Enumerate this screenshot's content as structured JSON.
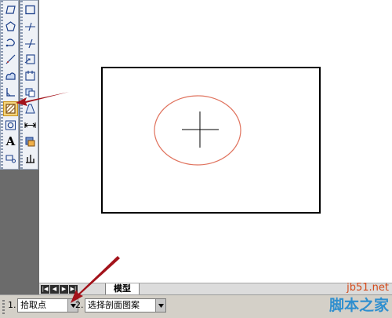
{
  "colors": {
    "toolbar_bg": "#eef1f6",
    "selected_tool": "#f3d37a",
    "ellipse_stroke": "#e0735e",
    "arrow": "#a3131b",
    "watermark_domain": "#d44a1a",
    "watermark_name": "#2f8fcf"
  },
  "toolbar_left": [
    {
      "icon": "polyline-icon"
    },
    {
      "icon": "polygon-icon"
    },
    {
      "icon": "revision-cloud-icon"
    },
    {
      "icon": "spline-icon"
    },
    {
      "icon": "region-icon"
    },
    {
      "icon": "point-icon"
    },
    {
      "icon": "hatch-icon",
      "selected": true
    },
    {
      "icon": "ellipse-icon"
    },
    {
      "icon": "multiline-text-icon",
      "label": "A"
    },
    {
      "icon": "insert-table-icon"
    }
  ],
  "toolbar_right": [
    {
      "icon": "rectangle-icon"
    },
    {
      "icon": "line-icon"
    },
    {
      "icon": "ray-icon"
    },
    {
      "icon": "insert-block-icon"
    },
    {
      "icon": "make-block-icon"
    },
    {
      "icon": "offset-icon"
    },
    {
      "icon": "gradient-icon"
    },
    {
      "icon": "dimension-icon"
    },
    {
      "icon": "layer-icon"
    },
    {
      "icon": "properties-icon"
    }
  ],
  "layout_tabs": {
    "nav_buttons": [
      "first",
      "previous",
      "next",
      "last"
    ],
    "active_tab": "模型"
  },
  "command_bar": {
    "option1_number": "1.",
    "option1_value": "拾取点",
    "option2_number": "2.",
    "option2_value": "选择剖面图案"
  },
  "watermark": {
    "domain": "jb51.net",
    "name": "脚本之家"
  }
}
